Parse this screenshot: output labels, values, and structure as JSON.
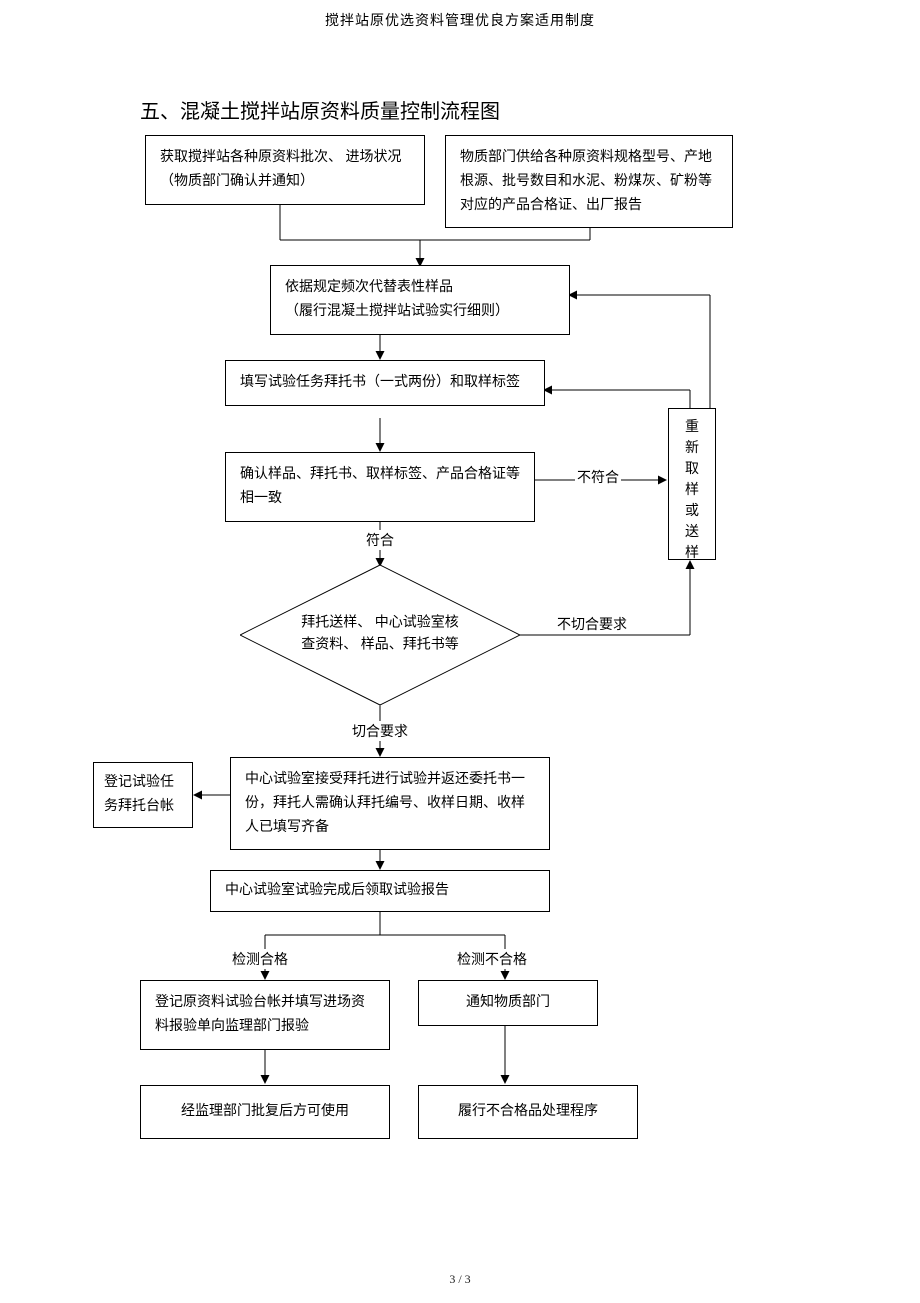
{
  "header": "搅拌站原优选资料管理优良方案适用制度",
  "title": "五、混凝土搅拌站原资料质量控制流程图",
  "nodes": {
    "n1": "获取搅拌站各种原资料批次、   进场状况（物质部门确认并通知）",
    "n2": "物质部门供给各种原资料规格型号、产地根源、批号数目和水泥、粉煤灰、矿粉等对应的产品合格证、出厂报告",
    "n3": "依据规定频次代替表性样品\n（履行混凝土搅拌站试验实行细则）",
    "n4": "填写试验任务拜托书（一式两份）和取样标签",
    "n5": "确认样品、拜托书、取样标签、产品合格证等相一致",
    "n6": "拜托送样、 中心试验室核查资料、 样品、拜托书等",
    "n7": "重新取样或送样",
    "n8": "中心试验室接受拜托进行试验并返还委托书一份，拜托人需确认拜托编号、收样日期、收样人已填写齐备",
    "n9": "登记试验任务拜托台帐",
    "n10": "中心试验室试验完成后领取试验报告",
    "n11": "登记原资料试验台帐并填写进场资料报验单向监理部门报验",
    "n12": "通知物质部门",
    "n13": "经监理部门批复后方可使用",
    "n14": "履行不合格品处理程序"
  },
  "edges": {
    "e_nonconform": "不符合",
    "e_conform": "符合",
    "e_meet": "切合要求",
    "e_notmeet": "不切合要求",
    "e_pass": "检测合格",
    "e_fail": "检测不合格"
  },
  "footer": "3 / 3"
}
